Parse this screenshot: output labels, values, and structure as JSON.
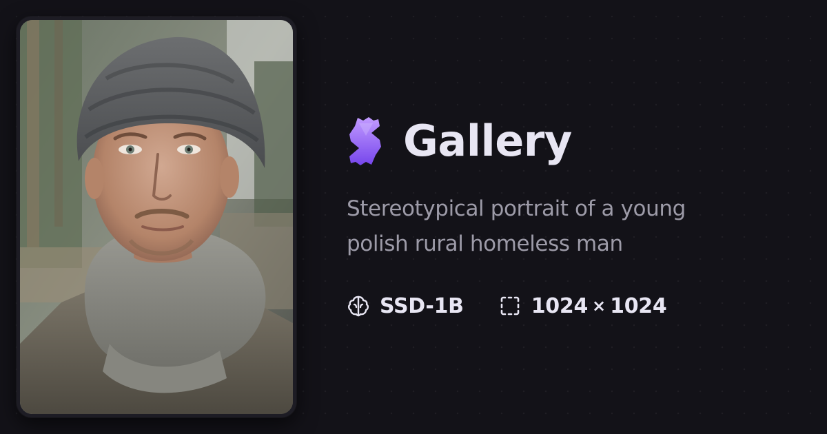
{
  "header": {
    "title": "Gallery",
    "logo_icon": "spark-logo-icon",
    "logo_colors": [
      "#b48bff",
      "#7a4df0"
    ]
  },
  "item": {
    "description": "Stereotypical portrait of a young polish rural homeless man",
    "model": {
      "icon": "brain-icon",
      "label": "SSD-1B"
    },
    "dimensions": {
      "icon": "dashed-frame-icon",
      "width": "1024",
      "separator": "×",
      "height": "1024"
    }
  },
  "thumbnail": {
    "alt": "Portrait of a young man in a grey knit beanie and grey scarf"
  },
  "colors": {
    "background": "#131218",
    "title": "#e8e6f3",
    "description": "#9d9ba8",
    "accent": "#8f5cf7"
  }
}
